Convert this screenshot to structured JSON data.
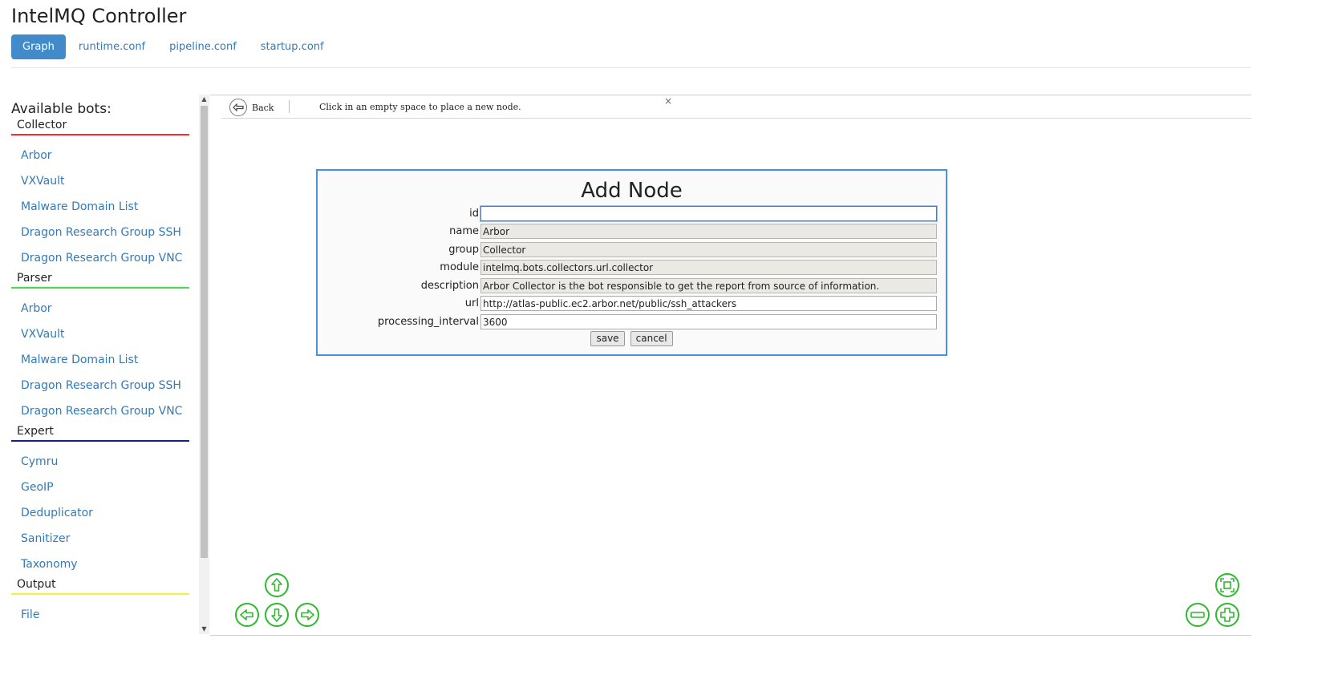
{
  "app": {
    "title": "IntelMQ Controller"
  },
  "nav": {
    "tabs": [
      "Graph",
      "runtime.conf",
      "pipeline.conf",
      "startup.conf"
    ]
  },
  "sidebar": {
    "heading": "Available bots:",
    "groups": [
      {
        "title": "Collector",
        "bots": [
          "Arbor",
          "VXVault",
          "Malware Domain List",
          "Dragon Research Group SSH",
          "Dragon Research Group VNC"
        ]
      },
      {
        "title": "Parser",
        "bots": [
          "Arbor",
          "VXVault",
          "Malware Domain List",
          "Dragon Research Group SSH",
          "Dragon Research Group VNC"
        ]
      },
      {
        "title": "Expert",
        "bots": [
          "Cymru",
          "GeoIP",
          "Deduplicator",
          "Sanitizer",
          "Taxonomy"
        ]
      },
      {
        "title": "Output",
        "bots": [
          "File"
        ]
      }
    ],
    "colors": {
      "collector": "#ff2b2b",
      "parser": "#44dd44",
      "expert": "#1a1aaa",
      "output": "#f0f040"
    }
  },
  "manipulation": {
    "back_label": "Back",
    "hint": "Click in an empty space to place a new node.",
    "close": "×"
  },
  "dialog": {
    "title": "Add Node",
    "fields": {
      "id": {
        "label": "id",
        "value": ""
      },
      "name": {
        "label": "name",
        "value": "Arbor"
      },
      "group": {
        "label": "group",
        "value": "Collector"
      },
      "module": {
        "label": "module",
        "value": "intelmq.bots.collectors.url.collector"
      },
      "description": {
        "label": "description",
        "value": "Arbor Collector is the bot responsible to get the report from source of information."
      },
      "url": {
        "label": "url",
        "value": "http://atlas-public.ec2.arbor.net/public/ssh_attackers"
      },
      "processing_interval": {
        "label": "processing_interval",
        "value": "3600"
      }
    },
    "save_label": "save",
    "cancel_label": "cancel"
  },
  "graph_controls": {
    "icons": [
      "arrow-up-icon",
      "arrow-left-icon",
      "arrow-down-icon",
      "arrow-right-icon",
      "zoom-extends-icon",
      "zoom-out-icon",
      "zoom-in-icon"
    ],
    "color": "#2fb92f"
  }
}
